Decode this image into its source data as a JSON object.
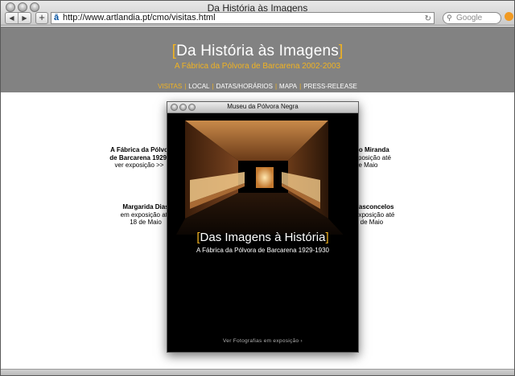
{
  "window": {
    "title": "Da História às Imagens"
  },
  "toolbar": {
    "back_label": "◀",
    "forward_label": "▶",
    "add_label": "+",
    "url": "http://www.artlandia.pt/cmo/visitas.html",
    "search_placeholder": "Google"
  },
  "site": {
    "title_open": "[",
    "title_text": "Da História às Imagens",
    "title_close": "]",
    "subtitle": "A Fábrica da Pólvora de Barcarena 2002-2003",
    "menu": [
      {
        "label": "VISITAS"
      },
      {
        "label": "LOCAL"
      },
      {
        "label": "DATAS/HORÁRIOS"
      },
      {
        "label": "MAPA"
      },
      {
        "label": "PRESS-RELEASE"
      }
    ],
    "separator": "|"
  },
  "exhibitions": {
    "left_top": {
      "line1": "A Fábrica da Pólvo",
      "line2": "de Barcarena 1929-",
      "line3": "ver exposição >>"
    },
    "right_top": {
      "line1": "no Miranda",
      "line2": "xposição até",
      "line3": "de Maio"
    },
    "left_bottom": {
      "line1": "Margarida Dias",
      "line2": "em exposição até",
      "line3": "18 de Maio"
    },
    "right_bottom": {
      "line1": "Vasconcelos",
      "line2": "exposição até",
      "line3": "8 de Maio"
    }
  },
  "popup": {
    "title": "Museu da Pólvora Negra",
    "heading_open": "[",
    "heading_text": "Das Imagens à História",
    "heading_close": "]",
    "subtitle": "A Fábrica da Pólvora de Barcarena 1929-1930",
    "link_label": "Ver Fotografias em exposição ›"
  },
  "colors": {
    "accent": "#f1b321",
    "banner": "#828282"
  }
}
